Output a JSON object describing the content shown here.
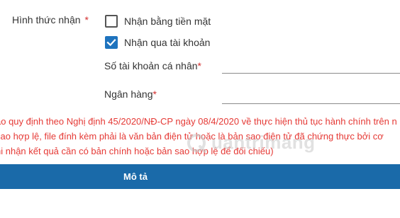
{
  "form": {
    "receive_method": {
      "label": "Hình thức nhận",
      "required_mark": "*",
      "options": [
        {
          "label": "Nhận bằng tiền mặt",
          "checked": false
        },
        {
          "label": "Nhận qua tài khoản",
          "checked": true
        }
      ]
    },
    "account_number": {
      "label": "Số tài khoản cá nhân",
      "required_mark": "*",
      "value": ""
    },
    "bank": {
      "label": "Ngân hàng",
      "required_mark": "*",
      "value": ""
    }
  },
  "notes": [
    "ao quy định theo Nghị định 45/2020/NĐ-CP ngày 08/4/2020 về thực hiện thủ tục hành chính trên n",
    "sao hợp lệ, file đính kèm phải là văn bản điện tử hoặc là bản sao điện tử đã chứng thực bởi cơ",
    "hi nhận kết quả cần có bản chính hoặc bản sao hợp lệ để đối chiếu)"
  ],
  "section_bar": {
    "title": "Mô tả"
  },
  "watermark": {
    "text": "uantrimang",
    "icon": "watermark-logo-icon"
  },
  "colors": {
    "accent": "#1a6aa9",
    "checkbox": "#1e73be",
    "note": "#e53935",
    "required": "#d32f2f"
  }
}
